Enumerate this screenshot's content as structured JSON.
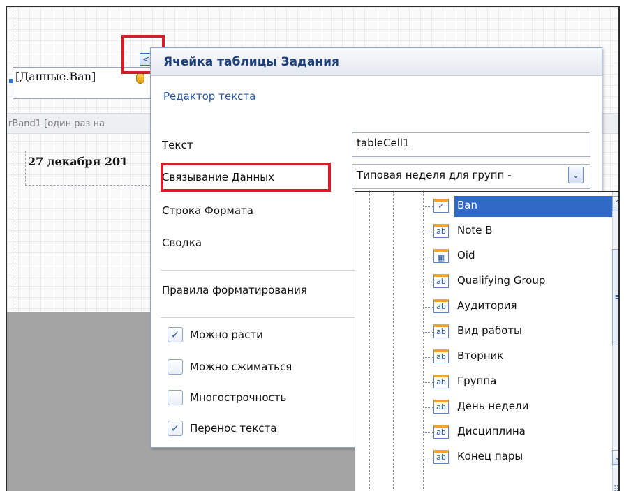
{
  "canvas": {
    "field_expression": "[Данные.Ban]",
    "band_caption": "rBand1 [один раз на",
    "date_text": "27 декабря 201"
  },
  "smart_tag": {
    "glyph": "<"
  },
  "panel": {
    "title": "Ячейка таблицы Задания",
    "editor_link": "Редактор текста",
    "labels": {
      "text": "Текст",
      "data_binding": "Связывание Данных",
      "format_string": "Строка Формата",
      "summary": "Сводка",
      "formatting_rules": "Правила форматирования"
    },
    "text_value": "tableCell1",
    "binding_value": "Типовая неделя для групп -",
    "binding_arrow": "⌄",
    "checkboxes": [
      {
        "label": "Можно расти",
        "checked": true
      },
      {
        "label": "Можно сжиматься",
        "checked": false
      },
      {
        "label": "Многострочность",
        "checked": false
      },
      {
        "label": "Перенос текста",
        "checked": true
      }
    ]
  },
  "field_tree": {
    "items": [
      {
        "label": "Ban",
        "icon": "check-icon",
        "selected": true
      },
      {
        "label": "Note B",
        "icon": "text-field-icon",
        "selected": false
      },
      {
        "label": "Oid",
        "icon": "table-field-icon",
        "selected": false
      },
      {
        "label": "Qualifying Group",
        "icon": "text-field-icon",
        "selected": false
      },
      {
        "label": "Аудитория",
        "icon": "text-field-icon",
        "selected": false
      },
      {
        "label": "Вид работы",
        "icon": "text-field-icon",
        "selected": false
      },
      {
        "label": "Вторник",
        "icon": "text-field-icon",
        "selected": false
      },
      {
        "label": "Группа",
        "icon": "text-field-icon",
        "selected": false
      },
      {
        "label": "День недели",
        "icon": "text-field-icon",
        "selected": false
      },
      {
        "label": "Дисциплина",
        "icon": "text-field-icon",
        "selected": false
      },
      {
        "label": "Конец пары",
        "icon": "text-field-icon",
        "selected": false
      }
    ],
    "icon_glyphs": {
      "check": "✓",
      "text": "ab",
      "grid": "▦"
    },
    "scroll_glyphs": {
      "up": "^",
      "thumb": "≡",
      "down": "⌄",
      "grip": "⠿"
    }
  },
  "colors": {
    "highlight_red": "#d21f2a",
    "selection_blue": "#3169c6",
    "title_blue": "#1d3f7a"
  }
}
